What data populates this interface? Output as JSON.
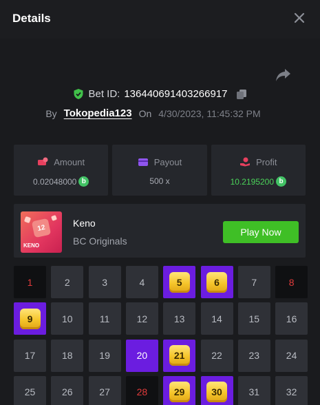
{
  "modal": {
    "title": "Details"
  },
  "bet": {
    "id_label": "Bet ID:",
    "id_value": "136440691403266917",
    "by_label": "By",
    "username": "Tokopedia123",
    "on_label": "On",
    "date": "4/30/2023, 11:45:32 PM"
  },
  "stats": {
    "amount": {
      "label": "Amount",
      "value": "0.02048000",
      "icon": "money-icon"
    },
    "payout": {
      "label": "Payout",
      "value": "500 x",
      "icon": "wallet-icon"
    },
    "profit": {
      "label": "Profit",
      "value": "10.2195200",
      "icon": "hand-coin-icon"
    },
    "currency_symbol": "b"
  },
  "game": {
    "name": "Keno",
    "provider": "BC Originals",
    "thumb_number": "12",
    "thumb_label": "KENO",
    "play_label": "Play Now"
  },
  "grid": {
    "cells": [
      {
        "n": "1",
        "state": "hit-miss"
      },
      {
        "n": "2",
        "state": "normal"
      },
      {
        "n": "3",
        "state": "normal"
      },
      {
        "n": "4",
        "state": "normal"
      },
      {
        "n": "5",
        "state": "sel-hit"
      },
      {
        "n": "6",
        "state": "sel-hit"
      },
      {
        "n": "7",
        "state": "normal"
      },
      {
        "n": "8",
        "state": "hit-miss"
      },
      {
        "n": "9",
        "state": "sel-hit"
      },
      {
        "n": "10",
        "state": "normal"
      },
      {
        "n": "11",
        "state": "normal"
      },
      {
        "n": "12",
        "state": "normal"
      },
      {
        "n": "13",
        "state": "normal"
      },
      {
        "n": "14",
        "state": "normal"
      },
      {
        "n": "15",
        "state": "normal"
      },
      {
        "n": "16",
        "state": "normal"
      },
      {
        "n": "17",
        "state": "normal"
      },
      {
        "n": "18",
        "state": "normal"
      },
      {
        "n": "19",
        "state": "normal"
      },
      {
        "n": "20",
        "state": "sel-only"
      },
      {
        "n": "21",
        "state": "sel-hit"
      },
      {
        "n": "22",
        "state": "normal"
      },
      {
        "n": "23",
        "state": "normal"
      },
      {
        "n": "24",
        "state": "normal"
      },
      {
        "n": "25",
        "state": "normal"
      },
      {
        "n": "26",
        "state": "normal"
      },
      {
        "n": "27",
        "state": "normal"
      },
      {
        "n": "28",
        "state": "hit-miss"
      },
      {
        "n": "29",
        "state": "sel-hit"
      },
      {
        "n": "30",
        "state": "sel-hit"
      },
      {
        "n": "31",
        "state": "normal"
      },
      {
        "n": "32",
        "state": "normal"
      }
    ]
  },
  "colors": {
    "accent_green": "#3fbf26",
    "selected_purple": "#6b1de0",
    "miss_red": "#e23b3b",
    "gem_gold": "#f5c52b"
  }
}
